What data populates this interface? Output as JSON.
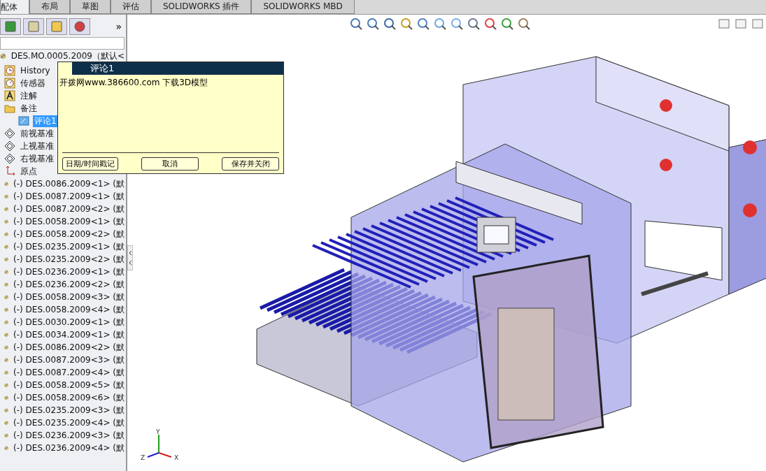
{
  "tabs": [
    {
      "label": "配体",
      "selected": true
    },
    {
      "label": "布局",
      "selected": false
    },
    {
      "label": "草图",
      "selected": false
    },
    {
      "label": "评估",
      "selected": false
    },
    {
      "label": "SOLIDWORKS 插件",
      "selected": false
    },
    {
      "label": "SOLIDWORKS MBD",
      "selected": false
    }
  ],
  "panel_more": "»",
  "tree": {
    "root": "DES.MO.0005.2009（默认<",
    "items": [
      {
        "kind": "history",
        "label": "History",
        "selected": false
      },
      {
        "kind": "sensor",
        "label": "传感器",
        "selected": false
      },
      {
        "kind": "annotation",
        "label": "注解",
        "selected": false
      },
      {
        "kind": "folder",
        "label": "备注",
        "selected": false,
        "children": [
          {
            "kind": "comment",
            "label": "评论1",
            "selected": true
          }
        ]
      },
      {
        "kind": "plane",
        "label": "前视基准",
        "selected": false
      },
      {
        "kind": "plane",
        "label": "上视基准",
        "selected": false
      },
      {
        "kind": "plane",
        "label": "右视基准",
        "selected": false
      },
      {
        "kind": "origin",
        "label": "原点",
        "selected": false
      },
      {
        "kind": "component",
        "label": "(-) DES.0086.2009<1> (默",
        "selected": false
      },
      {
        "kind": "component",
        "label": "(-) DES.0087.2009<1> (默",
        "selected": false
      },
      {
        "kind": "component",
        "label": "(-) DES.0087.2009<2> (默",
        "selected": false
      },
      {
        "kind": "component",
        "label": "(-) DES.0058.2009<1> (默",
        "selected": false
      },
      {
        "kind": "component",
        "label": "(-) DES.0058.2009<2> (默",
        "selected": false
      },
      {
        "kind": "component",
        "label": "(-) DES.0235.2009<1> (默",
        "selected": false
      },
      {
        "kind": "component",
        "label": "(-) DES.0235.2009<2> (默",
        "selected": false
      },
      {
        "kind": "component",
        "label": "(-) DES.0236.2009<1> (默",
        "selected": false
      },
      {
        "kind": "component",
        "label": "(-) DES.0236.2009<2> (默",
        "selected": false
      },
      {
        "kind": "component",
        "label": "(-) DES.0058.2009<3> (默",
        "selected": false
      },
      {
        "kind": "component",
        "label": "(-) DES.0058.2009<4> (默",
        "selected": false
      },
      {
        "kind": "component",
        "label": "(-) DES.0030.2009<1> (默",
        "selected": false
      },
      {
        "kind": "component",
        "label": "(-) DES.0034.2009<1> (默",
        "selected": false
      },
      {
        "kind": "component",
        "label": "(-) DES.0086.2009<2> (默",
        "selected": false
      },
      {
        "kind": "component",
        "label": "(-) DES.0087.2009<3> (默",
        "selected": false
      },
      {
        "kind": "component",
        "label": "(-) DES.0087.2009<4> (默",
        "selected": false
      },
      {
        "kind": "component",
        "label": "(-) DES.0058.2009<5> (默",
        "selected": false
      },
      {
        "kind": "component",
        "label": "(-) DES.0058.2009<6> (默",
        "selected": false
      },
      {
        "kind": "component",
        "label": "(-) DES.0235.2009<3> (默",
        "selected": false
      },
      {
        "kind": "component",
        "label": "(-) DES.0235.2009<4> (默",
        "selected": false
      },
      {
        "kind": "component",
        "label": "(-) DES.0236.2009<3> (默",
        "selected": false
      },
      {
        "kind": "component",
        "label": "(-) DES.0236.2009<4> (默",
        "selected": false
      }
    ]
  },
  "comment": {
    "title": "评论1",
    "text": "开拨网www.386600.com 下载3D模型",
    "buttons": [
      "日期/时间戳记",
      "取消",
      "保存并关闭"
    ]
  },
  "triad": {
    "x": "X",
    "y": "Y",
    "z": "Z"
  }
}
